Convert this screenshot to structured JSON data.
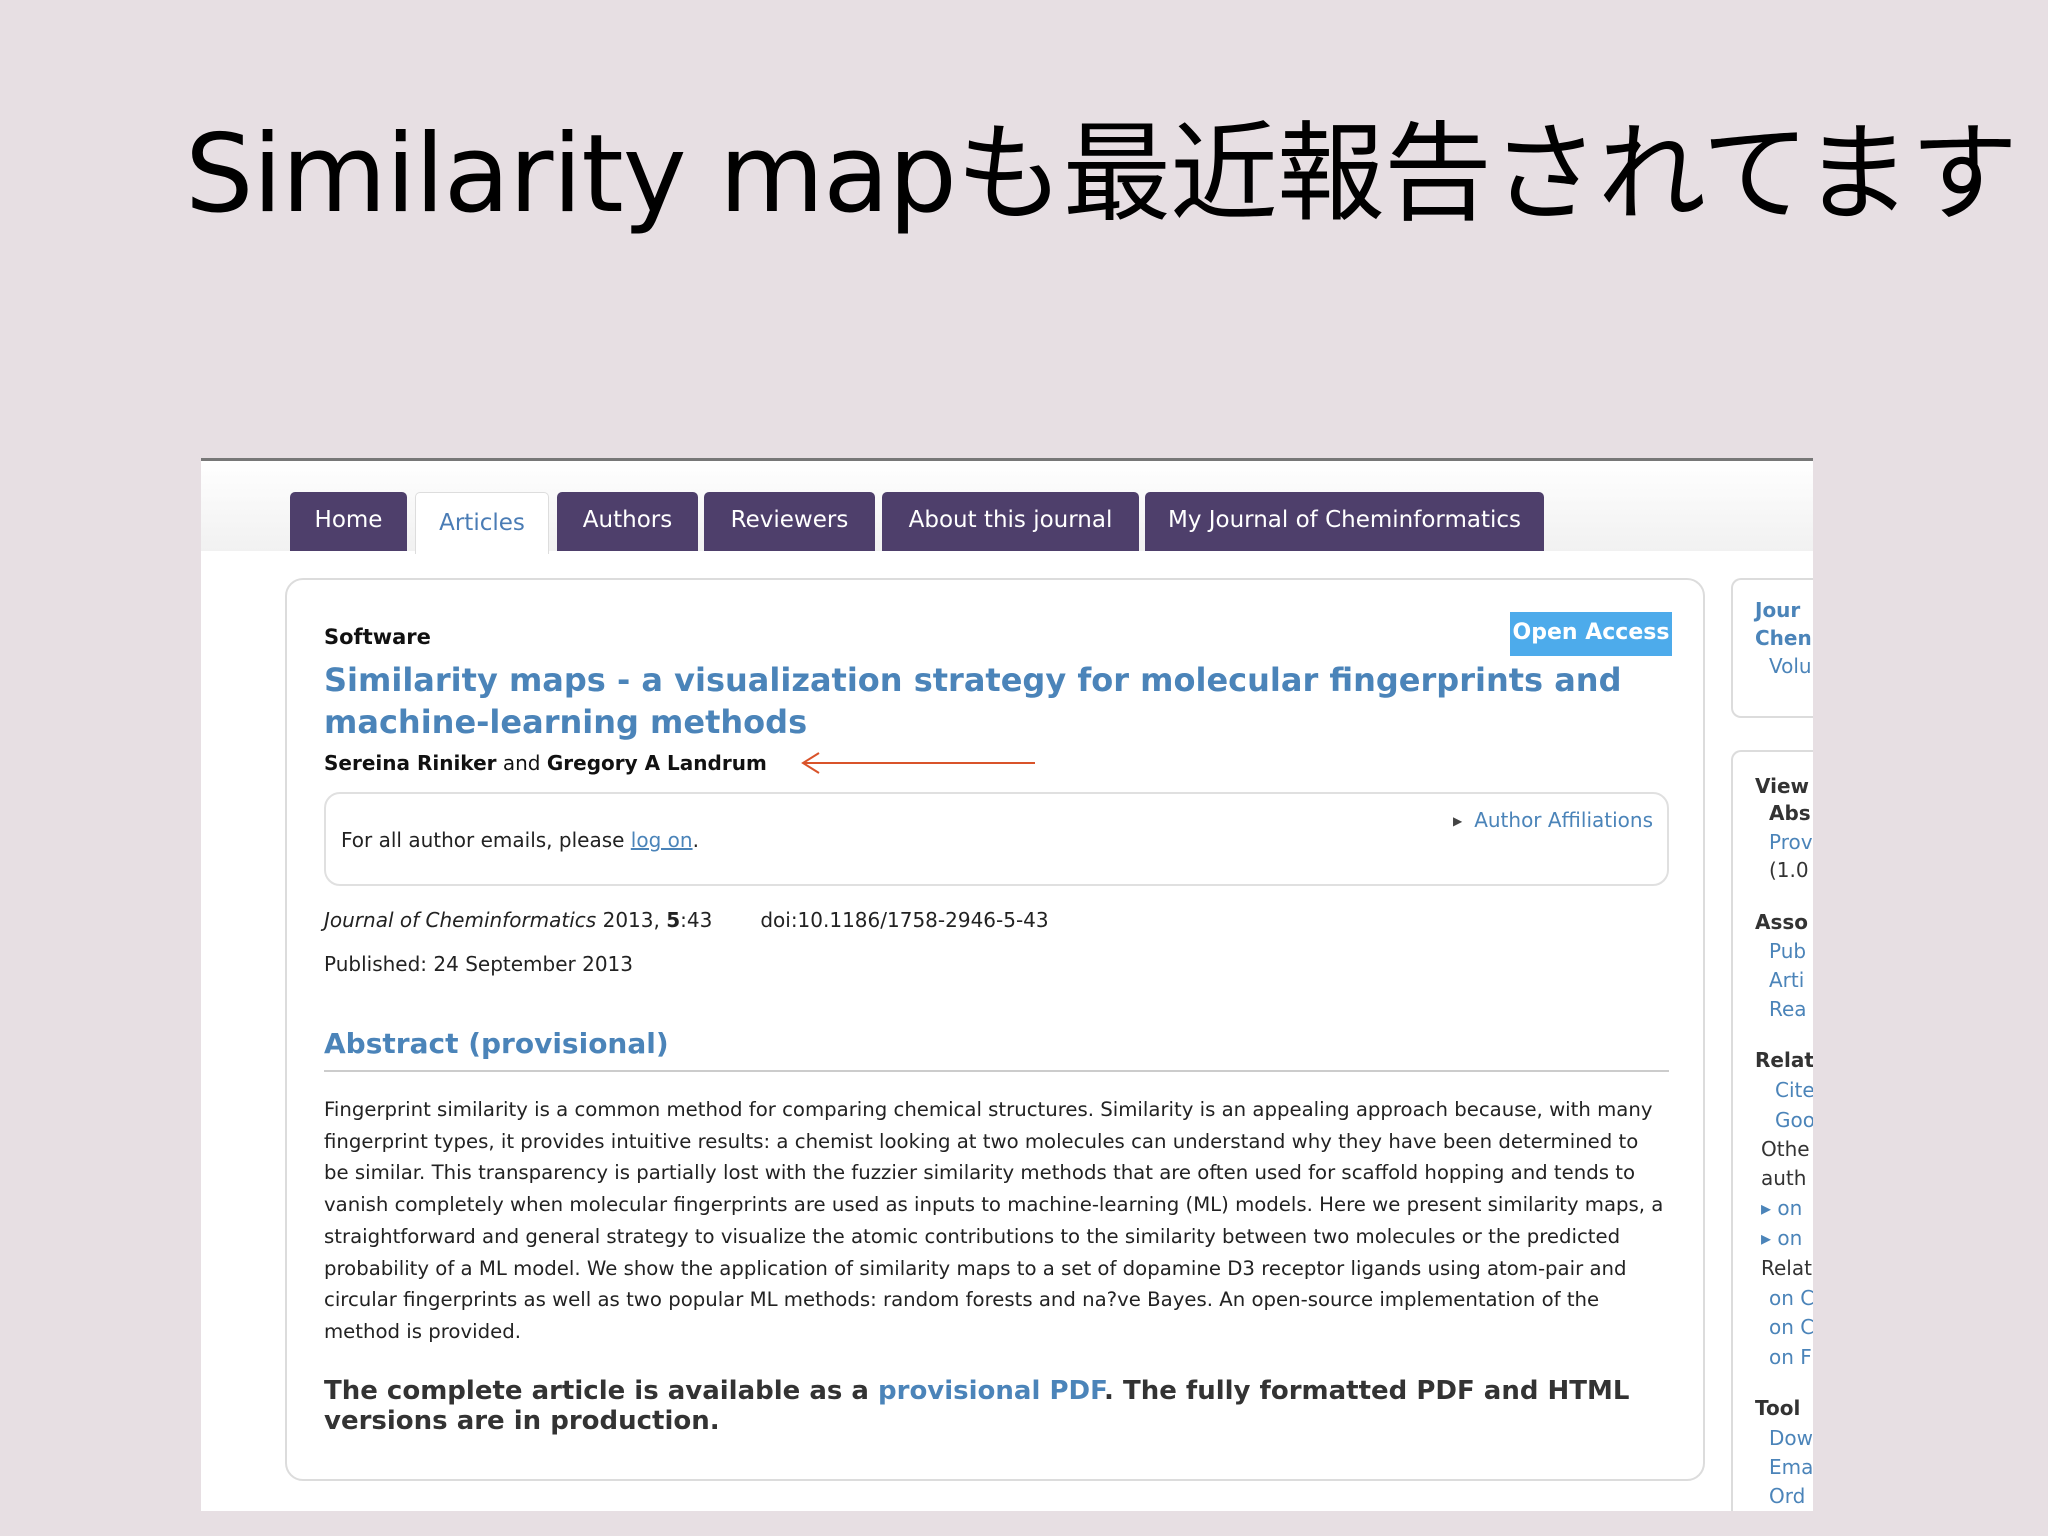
{
  "slide": {
    "title": "Similarity mapも最近報告されてます"
  },
  "nav": {
    "tabs": [
      {
        "label": "Home"
      },
      {
        "label": "Articles"
      },
      {
        "label": "Authors"
      },
      {
        "label": "Reviewers"
      },
      {
        "label": "About this journal"
      },
      {
        "label": "My Journal of Cheminformatics"
      }
    ],
    "active": "Articles"
  },
  "article": {
    "type": "Software",
    "badge": "Open Access",
    "title": "Similarity maps - a visualization strategy for molecular fingerprints and machine-learning methods",
    "author1": "Sereina Riniker",
    "author_joiner": " and ",
    "author2": "Gregory A Landrum",
    "affiliations_link": "Author Affiliations",
    "email_prefix": "For all author emails, please ",
    "email_link": "log on",
    "email_suffix": ".",
    "journal": "Journal of Cheminformatics",
    "year": " 2013, ",
    "volume": "5",
    "article_no": ":43",
    "doi": "doi:10.1186/1758-2946-5-43",
    "published": "Published: 24 September 2013",
    "abstract_heading": "Abstract (provisional)",
    "abstract": "Fingerprint similarity is a common method for comparing chemical structures. Similarity is an appealing approach because, with many fingerprint types, it provides intuitive results: a chemist looking at two molecules can understand why they have been determined to be similar. This transparency is partially lost with the fuzzier similarity methods that are often used for scaffold hopping and tends to vanish completely when molecular fingerprints are used as inputs to machine-learning (ML) models. Here we present similarity maps, a straightforward and general strategy to visualize the atomic contributions to the similarity between two molecules or the predicted probability of a ML model. We show the application of similarity maps to a set of dopamine D3 receptor ligands using atom-pair and circular fingerprints as well as two popular ML methods: random forests and na?ve Bayes. An open-source implementation of the method is provided.",
    "complete_prefix": "The complete article is available as a ",
    "complete_link": "provisional PDF",
    "complete_suffix": ". The fully formatted PDF and HTML versions are in production."
  },
  "sidebar": {
    "items": [
      "Jour",
      "Chen",
      "Volu",
      "View",
      "Abs",
      "Prov",
      "(1.0",
      "Asso",
      "Pub",
      "Arti",
      "Rea",
      "Relat",
      "Cite",
      "Goo",
      "Othe",
      "auth",
      "▸ on",
      "▸ on",
      "Relat",
      "on C",
      "on C",
      "on F",
      "Tool",
      "Dow",
      "Ema",
      "Ord"
    ]
  },
  "colors": {
    "slide_bg": "#e7dfe3",
    "tab_bg": "#4e3f6b",
    "link_blue": "#4b84b9",
    "badge_blue": "#4dabeb",
    "arrow_red": "#d9532a"
  }
}
